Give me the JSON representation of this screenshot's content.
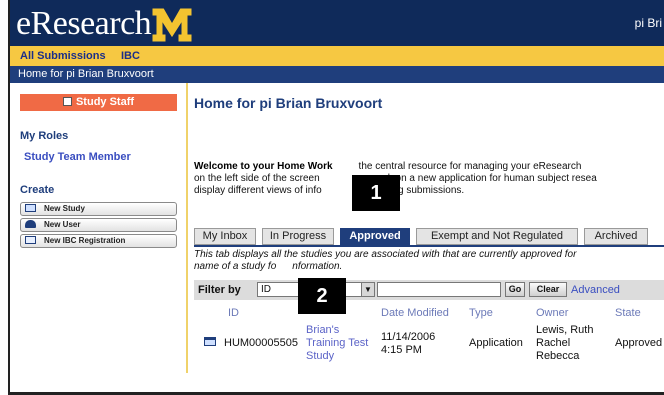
{
  "header": {
    "logo_text": "eResearch",
    "logo_letter": "M",
    "user_corner": "pi Bri"
  },
  "nav": {
    "links": [
      "All Submissions",
      "IBC"
    ]
  },
  "breadcrumb": "Home for pi Brian Bruxvoort",
  "sidebar": {
    "study_staff_button": "Study Staff",
    "my_roles_heading": "My Roles",
    "role": "Study Team Member",
    "create_heading": "Create",
    "create_buttons": [
      "New Study",
      "New User",
      "New IBC Registration"
    ]
  },
  "main": {
    "title": "Home for pi Brian Bruxvoort",
    "welcome_bold": "Welcome to your Home Work",
    "welcome_line1_rest": "the central resource for managing your eResearch",
    "welcome_line2_a": "on the left side of the screen",
    "welcome_line2_b": "work on a new application for human subject resea",
    "welcome_line3_a": "display different views of info",
    "welcome_line3_b": "existing submissions.",
    "tabs": [
      "My Inbox",
      "In Progress",
      "Approved",
      "Exempt and Not Regulated",
      "Archived"
    ],
    "active_tab": "Approved",
    "tab_desc_line1": "This tab displays all the studies you are associated with that are currently approved for",
    "tab_desc_line2_a": "name of a study fo",
    "tab_desc_line2_b": "nformation.",
    "filter": {
      "label": "Filter by",
      "selected": "ID",
      "go": "Go",
      "clear": "Clear",
      "advanced": "Advanced"
    },
    "columns": [
      "ID",
      "Date Modified",
      "Type",
      "Owner",
      "State"
    ],
    "rows": [
      {
        "id": "HUM00005505",
        "name_lines": [
          "Brian's",
          "Training Test",
          "Study"
        ],
        "date_lines": [
          "11/14/2006",
          "4:15 PM"
        ],
        "type": "Application",
        "owner_lines": [
          "Lewis, Ruth",
          "Rachel",
          "Rebecca"
        ],
        "state": "Approved"
      }
    ]
  },
  "callouts": [
    "1",
    "2"
  ],
  "colors": {
    "header_bg": "#0f2a5a",
    "nav_bg": "#f6c842",
    "crumb_bg": "#1f3e7c",
    "staff_button": "#f06a45",
    "accent": "#1f3e7c"
  }
}
